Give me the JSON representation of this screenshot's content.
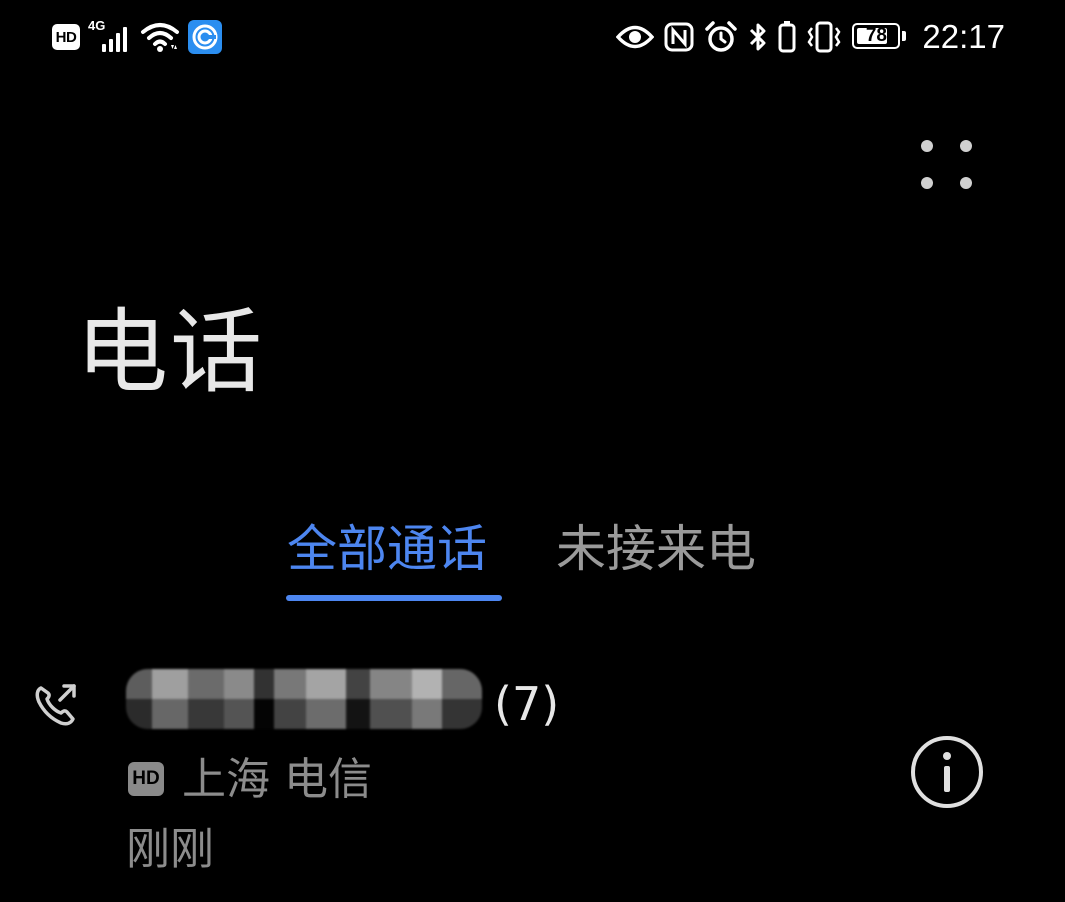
{
  "status_bar": {
    "hd_label": "HD",
    "network_label": "4G",
    "battery_level": 78,
    "battery_text": "78",
    "time": "22:17",
    "icons": [
      "hd-icon",
      "signal-icon",
      "wifi-icon",
      "app-notification-icon",
      "eye-comfort-icon",
      "nfc-icon",
      "alarm-icon",
      "bluetooth-icon",
      "vibrate-icon",
      "battery-icon"
    ]
  },
  "header": {
    "title": "电话",
    "more_icon": "more-dots-icon"
  },
  "tabs": [
    {
      "label": "全部通话",
      "active": true
    },
    {
      "label": "未接来电",
      "active": false
    }
  ],
  "colors": {
    "accent": "#4d86f0",
    "background": "#000000",
    "secondary_text": "#8c8c8c"
  },
  "call_log": [
    {
      "name_blurred": true,
      "count": "(7)",
      "hd_label": "HD",
      "location": "上海 电信",
      "time": "刚刚",
      "direction_icon": "outgoing-call-icon",
      "detail_icon": "info-icon"
    }
  ]
}
